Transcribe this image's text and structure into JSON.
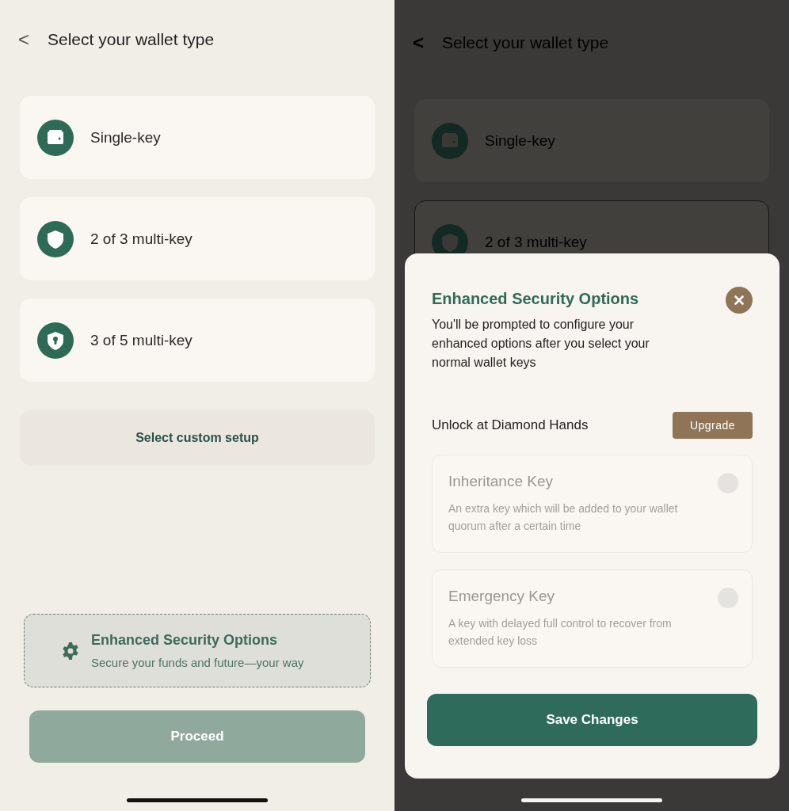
{
  "screens": [
    {
      "dimmed": false,
      "header": {
        "back": "<",
        "title": "Select your wallet type"
      },
      "wallet_options": [
        {
          "label": "Single-key",
          "selected": false
        },
        {
          "label": "2 of 3 multi-key",
          "selected": false
        },
        {
          "label": "3 of 5 multi-key",
          "selected": false
        }
      ],
      "custom_setup": "Select custom setup",
      "enhanced_card": {
        "title": "Enhanced Security Options",
        "subtitle": "Secure your funds and future—your way"
      },
      "proceed": {
        "label": "Proceed",
        "disabled": true
      }
    },
    {
      "dimmed": true,
      "header": {
        "back": "<",
        "title": "Select your wallet type"
      },
      "wallet_options": [
        {
          "label": "Single-key",
          "selected": false
        },
        {
          "label": "2 of 3 multi-key",
          "selected": true
        }
      ],
      "sheet": {
        "title": "Enhanced Security Options",
        "description": "You'll be prompted to configure your enhanced options after you select your normal wallet keys",
        "unlock_label": "Unlock at Diamond Hands",
        "upgrade": "Upgrade",
        "options": [
          {
            "title": "Inheritance Key",
            "description": "An extra key which will be added to your wallet quorum after a certain time",
            "on": false
          },
          {
            "title": "Emergency Key",
            "description": "A key with delayed full control to recover from extended key loss",
            "on": false
          }
        ],
        "save": "Save Changes"
      }
    }
  ]
}
